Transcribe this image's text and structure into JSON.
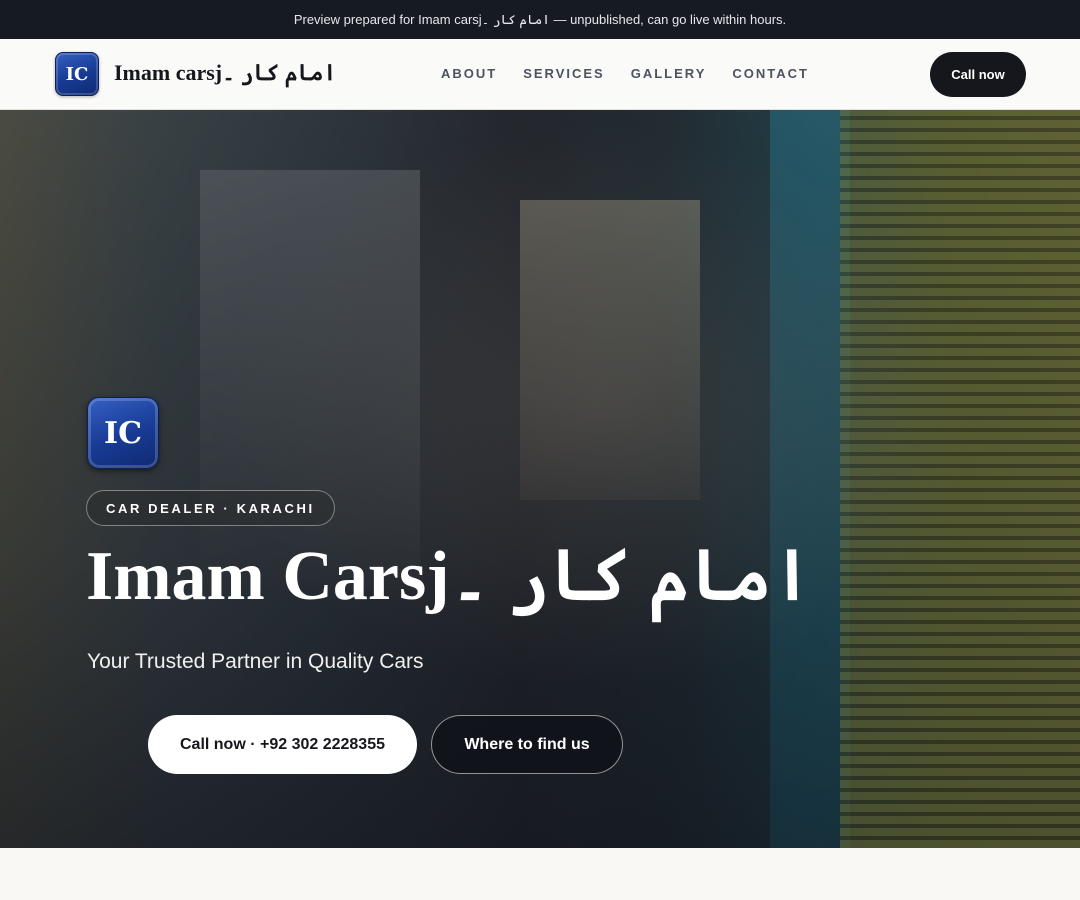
{
  "banner": {
    "text": "Preview prepared for Imam carsjامام کار ۔ — unpublished, can go live within hours."
  },
  "header": {
    "logo_initials": "IC",
    "brand_name": "Imam carsjامام کار ۔",
    "nav": [
      {
        "label": "ABOUT"
      },
      {
        "label": "SERVICES"
      },
      {
        "label": "GALLERY"
      },
      {
        "label": "CONTACT"
      }
    ],
    "cta_label": "Call now"
  },
  "hero": {
    "logo_initials": "IC",
    "tag": "CAR DEALER · KARACHI",
    "title": "Imam Carsjامام کار ۔",
    "subtitle": "Your Trusted Partner in Quality Cars",
    "primary_button": "Call now · +92 302 2228355",
    "secondary_button": "Where to find us"
  },
  "colors": {
    "banner_bg": "#161a23",
    "dark_button": "#15171c",
    "logo_blue": "#173a93",
    "page_bg": "#f9f8f5"
  }
}
